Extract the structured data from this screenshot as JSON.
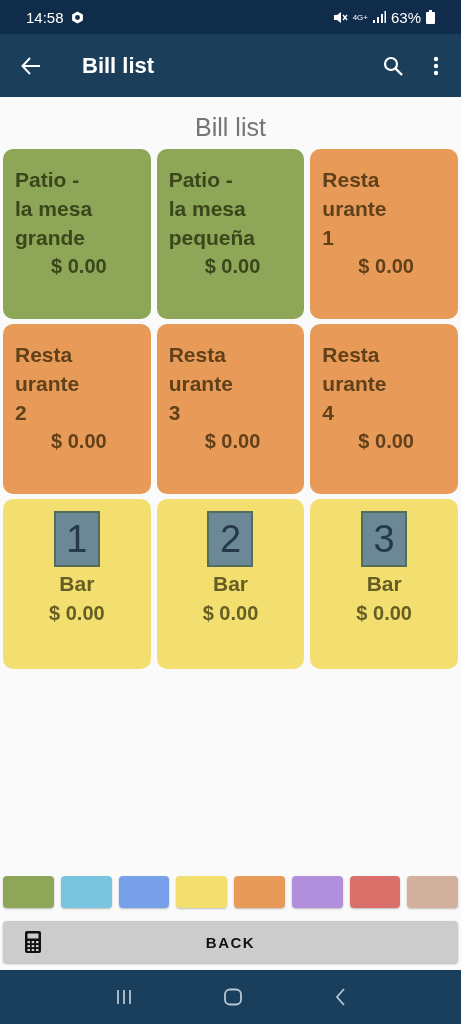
{
  "status_bar": {
    "time": "14:58",
    "battery": "63%",
    "network": "4G+"
  },
  "app_bar": {
    "title": "Bill list"
  },
  "heading": "Bill list",
  "bills": [
    {
      "kind": "table",
      "name": "Patio -\nla mesa\ngrande",
      "amount": "$ 0.00",
      "color": "#8da657"
    },
    {
      "kind": "table",
      "name": "Patio -\nla mesa\npequeña",
      "amount": "$ 0.00",
      "color": "#8da657"
    },
    {
      "kind": "table",
      "name": "Resta\nurante\n1",
      "amount": "$ 0.00",
      "color": "#e89b58"
    },
    {
      "kind": "table",
      "name": "Resta\nurante\n2",
      "amount": "$ 0.00",
      "color": "#e89b58"
    },
    {
      "kind": "table",
      "name": "Resta\nurante\n3",
      "amount": "$ 0.00",
      "color": "#e89b58"
    },
    {
      "kind": "table",
      "name": "Resta\nurante\n4",
      "amount": "$ 0.00",
      "color": "#e89b58"
    },
    {
      "kind": "bar",
      "number": "1",
      "name": "Bar",
      "amount": "$ 0.00",
      "color": "#f2df70"
    },
    {
      "kind": "bar",
      "number": "2",
      "name": "Bar",
      "amount": "$ 0.00",
      "color": "#f2df70"
    },
    {
      "kind": "bar",
      "number": "3",
      "name": "Bar",
      "amount": "$ 0.00",
      "color": "#f2df70"
    }
  ],
  "swatches": [
    {
      "color": "#8da657"
    },
    {
      "color": "#79c4de"
    },
    {
      "color": "#789fe9"
    },
    {
      "color": "#f2df70"
    },
    {
      "color": "#e89b58"
    },
    {
      "color": "#b08fdd"
    },
    {
      "color": "#db706a"
    },
    {
      "color": "#d2b19c"
    }
  ],
  "back_button": {
    "label": "BACK"
  }
}
